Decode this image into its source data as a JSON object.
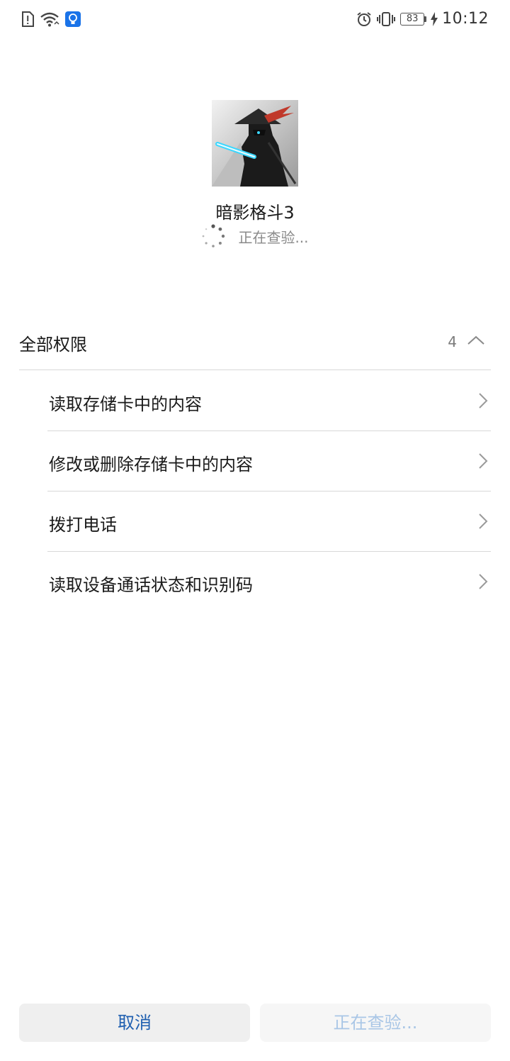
{
  "status_bar": {
    "time": "10:12",
    "battery": "83",
    "icons_left": [
      "sim-alert-icon",
      "wifi-icon",
      "notification-app-icon"
    ],
    "icons_right": [
      "alarm-icon",
      "vibrate-icon",
      "battery-icon",
      "charging-icon"
    ]
  },
  "app": {
    "name": "暗影格斗3",
    "status": "正在查验..."
  },
  "permissions": {
    "title": "全部权限",
    "count": "4",
    "items": [
      {
        "label": "读取存储卡中的内容"
      },
      {
        "label": "修改或删除存储卡中的内容"
      },
      {
        "label": "拨打电话"
      },
      {
        "label": "读取设备通话状态和识别码"
      }
    ]
  },
  "buttons": {
    "cancel": "取消",
    "verifying": "正在查验..."
  },
  "colors": {
    "accent": "#1f5fb0",
    "disabled_text": "#a9c6e6",
    "divider": "#d8d8d8"
  }
}
